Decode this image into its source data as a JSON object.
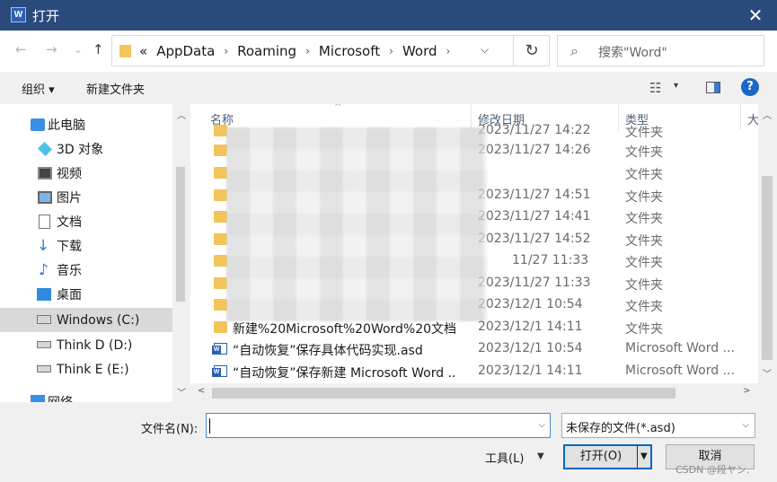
{
  "window": {
    "title": "打开",
    "app_icon": "word-icon",
    "close_glyph": "✕"
  },
  "nav": {
    "back": "←",
    "forward": "→",
    "recent": "⌄",
    "up": "↑"
  },
  "address": {
    "overflow": "«",
    "crumbs": [
      "AppData",
      "Roaming",
      "Microsoft",
      "Word"
    ],
    "separator": "›",
    "dropdown": "⌵",
    "refresh": "↻"
  },
  "search": {
    "icon": "⌕",
    "placeholder": "搜索\"Word\""
  },
  "toolbar": {
    "organize": "组织 ▾",
    "new_folder": "新建文件夹",
    "view_icon": "☷",
    "view_dd": "▾",
    "help": "?"
  },
  "sidebar": {
    "items": [
      {
        "label": "此电脑",
        "icon": "pc-icon"
      },
      {
        "label": "3D 对象",
        "icon": "3d-objects-icon"
      },
      {
        "label": "视频",
        "icon": "video-icon"
      },
      {
        "label": "图片",
        "icon": "pictures-icon"
      },
      {
        "label": "文档",
        "icon": "documents-icon"
      },
      {
        "label": "下载",
        "icon": "download-icon"
      },
      {
        "label": "音乐",
        "icon": "music-icon"
      },
      {
        "label": "桌面",
        "icon": "desktop-icon"
      },
      {
        "label": "Windows (C:)",
        "icon": "windows-drive-icon"
      },
      {
        "label": "Think D (D:)",
        "icon": "drive-icon"
      },
      {
        "label": "Think E (E:)",
        "icon": "drive-icon"
      },
      {
        "label": "网络",
        "icon": "network-icon"
      }
    ],
    "selected_index": 8
  },
  "columns": {
    "name": "名称",
    "date": "修改日期",
    "type": "类型",
    "size": "大",
    "sort_glyph": "^"
  },
  "rows": [
    {
      "name": "",
      "date": "2023/11/27 14:22",
      "type": "文件夹",
      "icon": "folder"
    },
    {
      "name": "",
      "date": "2023/11/27 14:26",
      "type": "文件夹",
      "icon": "folder"
    },
    {
      "name": "",
      "date": "",
      "type": "文件夹",
      "icon": "folder"
    },
    {
      "name": "",
      "date": "2023/11/27 14:51",
      "type": "文件夹",
      "icon": "folder"
    },
    {
      "name": "",
      "date": "2023/11/27 14:41",
      "type": "文件夹",
      "icon": "folder"
    },
    {
      "name": "",
      "date": "2023/11/27 14:52",
      "type": "文件夹",
      "icon": "folder"
    },
    {
      "name": "",
      "date": "11/27 11:33",
      "type": "文件夹",
      "icon": "folder"
    },
    {
      "name": "",
      "date": "2023/11/27 11:33",
      "type": "文件夹",
      "icon": "folder"
    },
    {
      "name": "",
      "date": "2023/12/1 10:54",
      "type": "文件夹",
      "icon": "folder"
    },
    {
      "name": "新建%20Microsoft%20Word%20文档...",
      "date": "2023/12/1 14:11",
      "type": "文件夹",
      "icon": "folder"
    },
    {
      "name": "“自动恢复”保存具体代码实现.asd",
      "date": "2023/12/1 10:54",
      "type": "Microsoft Word ...",
      "icon": "doc"
    },
    {
      "name": "“自动恢复”保存新建 Microsoft Word ...",
      "date": "2023/12/1 14:11",
      "type": "Microsoft Word ...",
      "icon": "doc"
    }
  ],
  "scroll": {
    "up": "︿",
    "down": "﹀",
    "left": "<",
    "right": ">"
  },
  "bottom": {
    "filename_label": "文件名(N):",
    "filename_value": "",
    "filetype": "未保存的文件(*.asd)",
    "dd": "⌵",
    "tools": "工具(L)",
    "tools_dd": "▼",
    "open": "打开(O)",
    "open_dd": "▼",
    "cancel": "取消"
  },
  "watermark": "CSDN @段ヤン."
}
